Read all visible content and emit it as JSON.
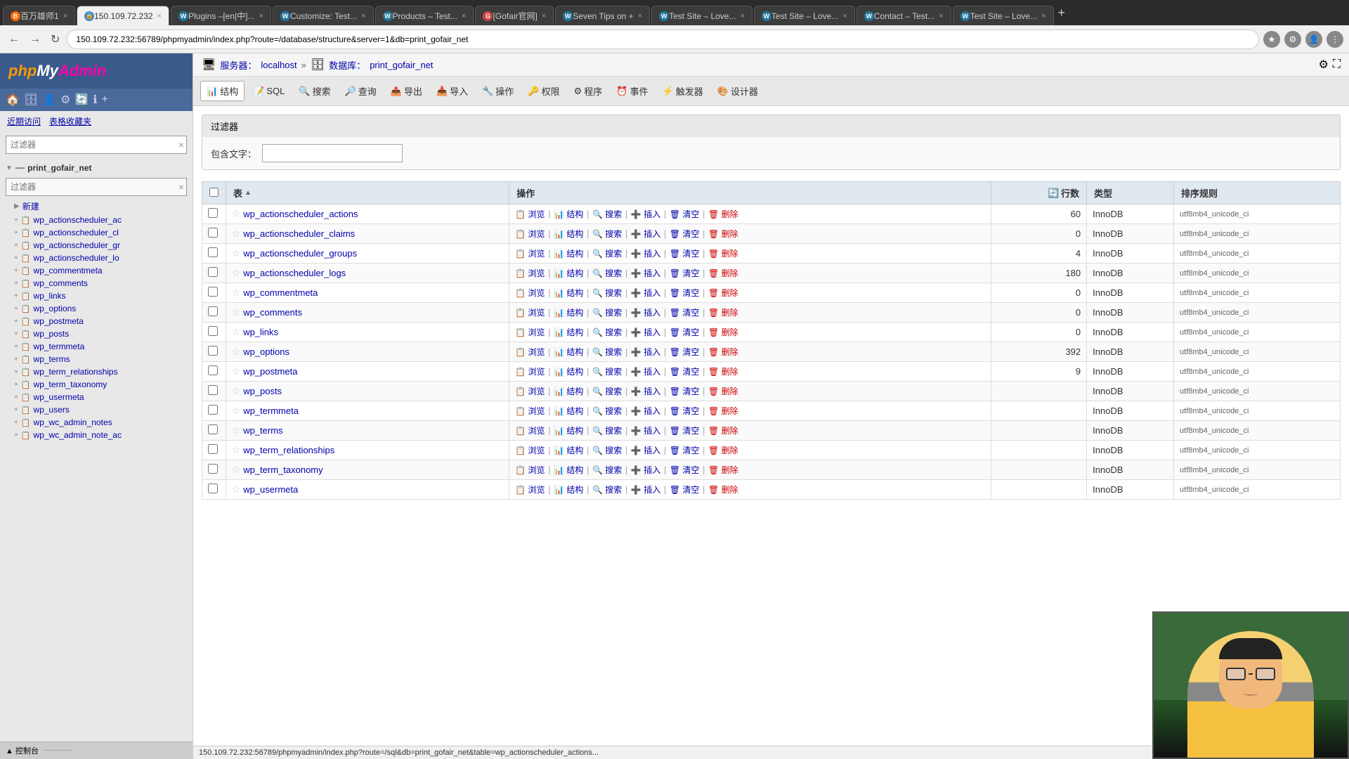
{
  "browser": {
    "tabs": [
      {
        "id": "tab1",
        "label": "百万雄师1",
        "favicon_color": "#ff6600",
        "favicon_text": "B",
        "active": false
      },
      {
        "id": "tab2",
        "label": "150.109.72.232",
        "favicon_color": "#4488cc",
        "favicon_text": "🔒",
        "active": true
      },
      {
        "id": "tab3",
        "label": "Plugins –[en|中]...",
        "favicon_color": "#21759b",
        "favicon_text": "W",
        "active": false
      },
      {
        "id": "tab4",
        "label": "Customize: Test...",
        "favicon_color": "#21759b",
        "favicon_text": "W",
        "active": false
      },
      {
        "id": "tab5",
        "label": "Products – Test...",
        "favicon_color": "#21759b",
        "favicon_text": "W",
        "active": false
      },
      {
        "id": "tab6",
        "label": "[Gofair官网]",
        "favicon_color": "#cc4444",
        "favicon_text": "G",
        "active": false
      },
      {
        "id": "tab7",
        "label": "Seven Tips on +",
        "favicon_color": "#21759b",
        "favicon_text": "W",
        "active": false
      },
      {
        "id": "tab8",
        "label": "Test Site – Love...",
        "favicon_color": "#21759b",
        "favicon_text": "W",
        "active": false
      },
      {
        "id": "tab9",
        "label": "Test Site – Love...",
        "favicon_color": "#21759b",
        "favicon_text": "W",
        "active": false
      },
      {
        "id": "tab10",
        "label": "Contact – Test...",
        "favicon_color": "#21759b",
        "favicon_text": "W",
        "active": false
      },
      {
        "id": "tab11",
        "label": "Test Site – Love...",
        "favicon_color": "#21759b",
        "favicon_text": "W",
        "active": false
      }
    ],
    "url": "150.109.72.232:56789/phpmyadmin/index.php?route=/database/structure&server=1&db=print_gofair_net",
    "status_bar": "150.109.72.232:56789/phpmyadmin/index.php?route=/sql&db=print_gofair_net&table=wp_actionscheduler_actions..."
  },
  "sidebar": {
    "logo": "phpMyAdmin",
    "links": [
      "近期访问",
      "表格收藏夹"
    ],
    "filter_placeholder": "过滤器",
    "filter_clear": "×",
    "db_filter_placeholder": "过滤器",
    "db_name": "print_gofair_net",
    "new_item_label": "新建",
    "tables": [
      "wp_actionscheduler_ac",
      "wp_actionscheduler_cl",
      "wp_actionscheduler_gr",
      "wp_actionscheduler_lo",
      "wp_commentmeta",
      "wp_comments",
      "wp_links",
      "wp_options",
      "wp_postmeta",
      "wp_posts",
      "wp_termmeta",
      "wp_terms",
      "wp_term_relationships",
      "wp_term_taxonomy",
      "wp_usermeta",
      "wp_users",
      "wp_wc_admin_notes",
      "wp_wc_admin_note_ac"
    ]
  },
  "breadcrumb": {
    "server_label": "服务器：",
    "server_name": "localhost",
    "db_label": "数据库：",
    "db_name": "print_gofair_net"
  },
  "toolbar": {
    "buttons": [
      {
        "id": "structure",
        "label": "结构",
        "active": true
      },
      {
        "id": "sql",
        "label": "SQL"
      },
      {
        "id": "search",
        "label": "搜索"
      },
      {
        "id": "query",
        "label": "查询"
      },
      {
        "id": "export",
        "label": "导出"
      },
      {
        "id": "import",
        "label": "导入"
      },
      {
        "id": "operations",
        "label": "操作"
      },
      {
        "id": "permissions",
        "label": "权限"
      },
      {
        "id": "routines",
        "label": "程序"
      },
      {
        "id": "events",
        "label": "事件"
      },
      {
        "id": "triggers",
        "label": "触发器"
      },
      {
        "id": "designer",
        "label": "设计器"
      }
    ]
  },
  "filter_section": {
    "title": "过滤器",
    "label": "包含文字：",
    "input_value": ""
  },
  "table": {
    "columns": [
      "表",
      "操作",
      "行数",
      "类型",
      "排序规则"
    ],
    "rows": [
      {
        "name": "wp_actionscheduler_actions",
        "rows": 60,
        "type": "InnoDB",
        "collation": "utf8mb4_unicode_ci"
      },
      {
        "name": "wp_actionscheduler_claims",
        "rows": 0,
        "type": "InnoDB",
        "collation": "utf8mb4_unicode_ci"
      },
      {
        "name": "wp_actionscheduler_groups",
        "rows": 4,
        "type": "InnoDB",
        "collation": "utf8mb4_unicode_ci"
      },
      {
        "name": "wp_actionscheduler_logs",
        "rows": 180,
        "type": "InnoDB",
        "collation": "utf8mb4_unicode_ci"
      },
      {
        "name": "wp_commentmeta",
        "rows": 0,
        "type": "InnoDB",
        "collation": "utf8mb4_unicode_ci"
      },
      {
        "name": "wp_comments",
        "rows": 0,
        "type": "InnoDB",
        "collation": "utf8mb4_unicode_ci"
      },
      {
        "name": "wp_links",
        "rows": 0,
        "type": "InnoDB",
        "collation": "utf8mb4_unicode_ci"
      },
      {
        "name": "wp_options",
        "rows": 392,
        "type": "InnoDB",
        "collation": "utf8mb4_unicode_ci"
      },
      {
        "name": "wp_postmeta",
        "rows": 9,
        "type": "InnoDB",
        "collation": "utf8mb4_unicode_ci"
      },
      {
        "name": "wp_posts",
        "rows": "",
        "type": "InnoDB",
        "collation": "utf8mb4_unicode_ci"
      },
      {
        "name": "wp_termmeta",
        "rows": "",
        "type": "InnoDB",
        "collation": "utf8mb4_unicode_ci"
      },
      {
        "name": "wp_terms",
        "rows": "",
        "type": "InnoDB",
        "collation": "utf8mb4_unicode_ci"
      },
      {
        "name": "wp_term_relationships",
        "rows": "",
        "type": "InnoDB",
        "collation": "utf8mb4_unicode_ci"
      },
      {
        "name": "wp_term_taxonomy",
        "rows": "",
        "type": "InnoDB",
        "collation": "utf8mb4_unicode_ci"
      },
      {
        "name": "wp_usermeta",
        "rows": "",
        "type": "InnoDB",
        "collation": "utf8mb4_unicode_ci"
      }
    ],
    "actions": [
      "浏览",
      "结构",
      "搜索",
      "插入",
      "清空",
      "删除"
    ],
    "row_count_icon": "🔄"
  }
}
